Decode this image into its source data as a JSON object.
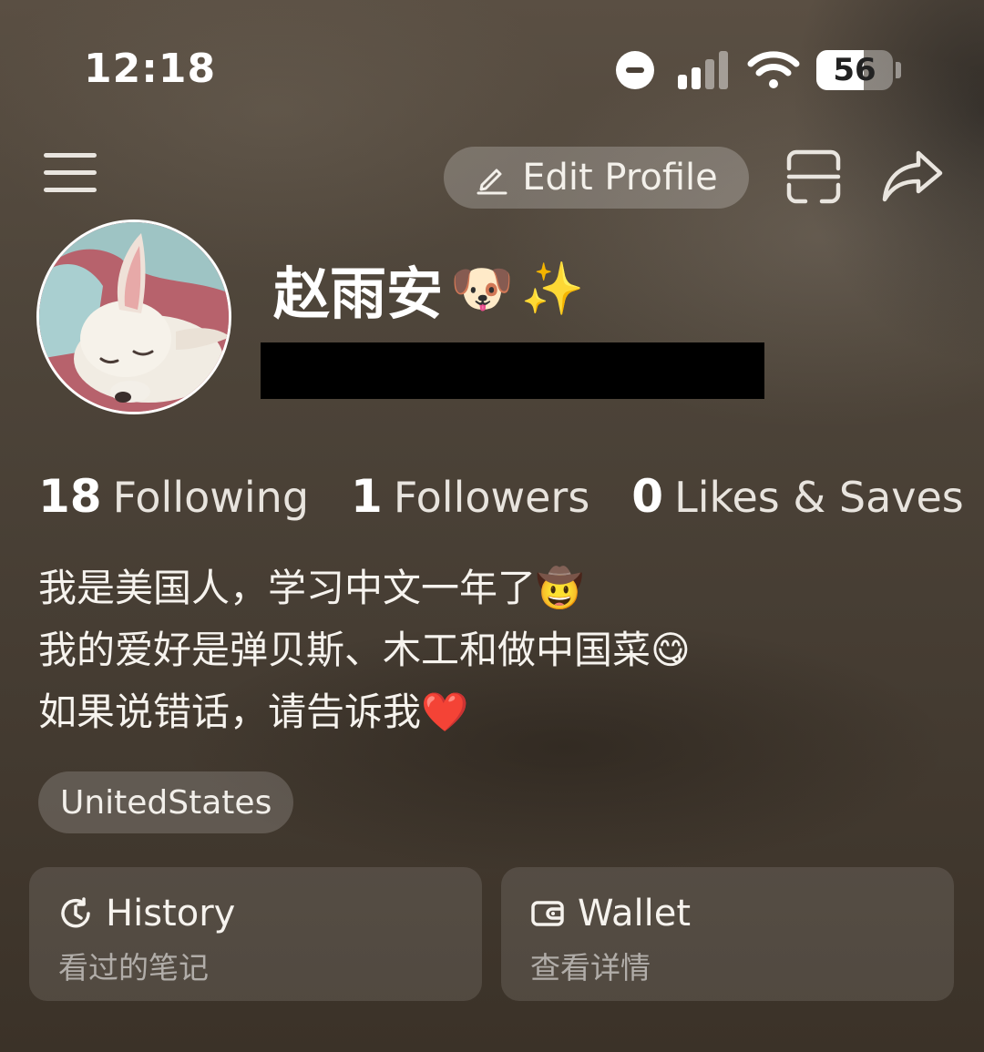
{
  "status_bar": {
    "time": "12:18",
    "battery_level": "56",
    "dnd_icon": "do-not-disturb-icon",
    "signal_icon": "cellular-signal-icon",
    "wifi_icon": "wifi-icon"
  },
  "nav": {
    "menu_icon": "hamburger-menu-icon",
    "edit_profile_label": "Edit Profile",
    "edit_icon": "pencil-icon",
    "scan_icon": "scan-icon",
    "share_icon": "share-icon"
  },
  "profile": {
    "name": "赵雨安",
    "name_emojis": [
      "🐶",
      "✨"
    ],
    "avatar_icon": "dog-avatar"
  },
  "stats": [
    {
      "count": "18",
      "label": "Following"
    },
    {
      "count": "1",
      "label": "Followers"
    },
    {
      "count": "0",
      "label": "Likes & Saves"
    }
  ],
  "bio": {
    "line1": "我是美国人，学习中文一年了🤠",
    "line2": "我的爱好是弹贝斯、木工和做中国菜😋",
    "line3": "如果说错话，请告诉我❤️"
  },
  "tag": "UnitedStates",
  "cards": [
    {
      "title": "History",
      "subtitle": "看过的笔记",
      "icon": "history-clock-icon"
    },
    {
      "title": "Wallet",
      "subtitle": "查看详情",
      "icon": "wallet-icon"
    }
  ],
  "colors": {
    "background_top": "#5a4f43",
    "background_bottom": "#3b3228",
    "redaction": "#000000"
  }
}
